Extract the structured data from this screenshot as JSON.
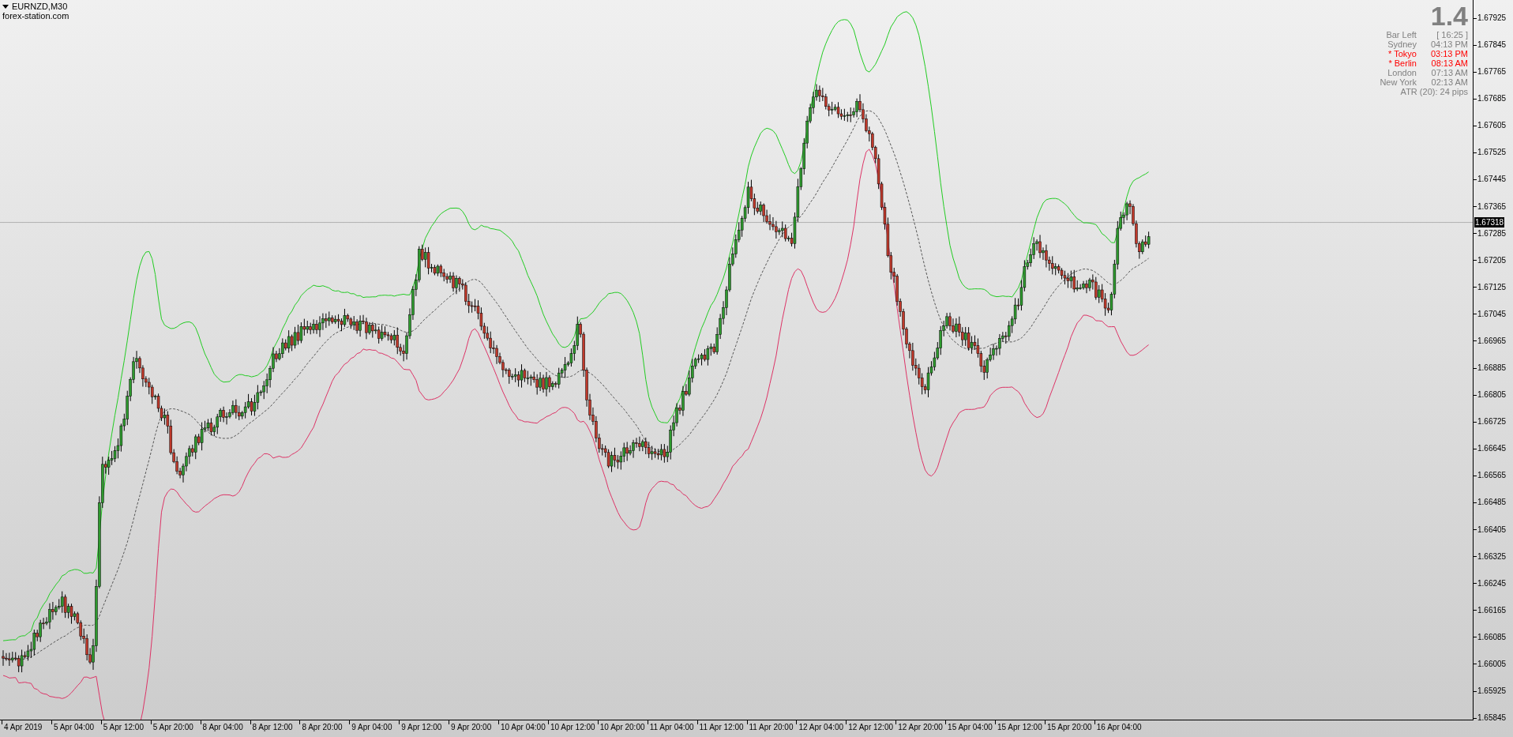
{
  "chart_header": {
    "symbol": "EURNZD,M30",
    "source": "forex-station.com"
  },
  "info_panel": {
    "value": "1.4",
    "rows": [
      {
        "label": "Bar Left",
        "value": "[ 16:25 ]",
        "highlighted": false
      },
      {
        "label": "Sydney",
        "value": "04:13 PM",
        "highlighted": false
      },
      {
        "label": "* Tokyo",
        "value": "03:13 PM",
        "highlighted": true
      },
      {
        "label": "* Berlin",
        "value": "08:13 AM",
        "highlighted": true
      },
      {
        "label": "London",
        "value": "07:13 AM",
        "highlighted": false
      },
      {
        "label": "New York",
        "value": "02:13 AM",
        "highlighted": false
      }
    ],
    "atr": "ATR (20): 24 pips"
  },
  "price_axis": {
    "labels": [
      "1.67925",
      "1.67845",
      "1.67765",
      "1.67685",
      "1.67605",
      "1.67525",
      "1.67445",
      "1.67365",
      "1.67285",
      "1.67205",
      "1.67125",
      "1.67045",
      "1.66965",
      "1.66885",
      "1.66805",
      "1.66725",
      "1.66645",
      "1.66565",
      "1.66485",
      "1.66405",
      "1.66325",
      "1.66245",
      "1.66165",
      "1.66085",
      "1.66005",
      "1.65925",
      "1.65845"
    ],
    "current_price": "1.67318"
  },
  "time_axis": {
    "labels": [
      "4 Apr 2019",
      "5 Apr 04:00",
      "5 Apr 12:00",
      "5 Apr 20:00",
      "8 Apr 04:00",
      "8 Apr 12:00",
      "8 Apr 20:00",
      "9 Apr 04:00",
      "9 Apr 12:00",
      "9 Apr 20:00",
      "10 Apr 04:00",
      "10 Apr 12:00",
      "10 Apr 20:00",
      "11 Apr 04:00",
      "11 Apr 12:00",
      "11 Apr 20:00",
      "12 Apr 04:00",
      "12 Apr 12:00",
      "12 Apr 20:00",
      "15 Apr 04:00",
      "15 Apr 12:00",
      "15 Apr 20:00",
      "16 Apr 04:00"
    ]
  }
}
